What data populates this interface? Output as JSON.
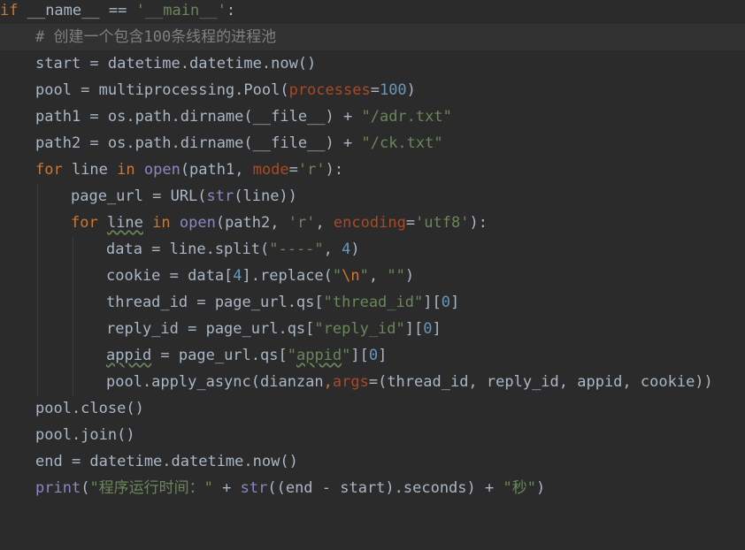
{
  "lines": [
    {
      "indent": 0,
      "current": false,
      "tokens": [
        {
          "t": "if ",
          "c": "kw"
        },
        {
          "t": "__name__",
          "c": "plain"
        },
        {
          "t": " == ",
          "c": "plain"
        },
        {
          "t": "'__main__'",
          "c": "str"
        },
        {
          "t": ":",
          "c": "plain"
        }
      ]
    },
    {
      "indent": 1,
      "current": true,
      "tokens": [
        {
          "t": "# 创建一个包含100条线程的进程池",
          "c": "cmt"
        }
      ]
    },
    {
      "indent": 1,
      "current": false,
      "tokens": [
        {
          "t": "start = datetime.datetime.now()",
          "c": "plain"
        }
      ]
    },
    {
      "indent": 1,
      "current": false,
      "tokens": [
        {
          "t": "pool = multiprocessing.Pool(",
          "c": "plain"
        },
        {
          "t": "processes",
          "c": "param"
        },
        {
          "t": "=",
          "c": "plain"
        },
        {
          "t": "100",
          "c": "num"
        },
        {
          "t": ")",
          "c": "plain"
        }
      ]
    },
    {
      "indent": 1,
      "current": false,
      "tokens": [
        {
          "t": "path1 = os.path.dirname(",
          "c": "plain"
        },
        {
          "t": "__file__",
          "c": "plain"
        },
        {
          "t": ") + ",
          "c": "plain"
        },
        {
          "t": "\"/adr.txt\"",
          "c": "str"
        }
      ]
    },
    {
      "indent": 1,
      "current": false,
      "tokens": [
        {
          "t": "path2 = os.path.dirname(",
          "c": "plain"
        },
        {
          "t": "__file__",
          "c": "plain"
        },
        {
          "t": ") + ",
          "c": "plain"
        },
        {
          "t": "\"/ck.txt\"",
          "c": "str"
        }
      ]
    },
    {
      "indent": 1,
      "current": false,
      "tokens": [
        {
          "t": "for ",
          "c": "kw"
        },
        {
          "t": "line ",
          "c": "plain"
        },
        {
          "t": "in ",
          "c": "kw"
        },
        {
          "t": "open",
          "c": "builtin"
        },
        {
          "t": "(path1, ",
          "c": "plain"
        },
        {
          "t": "mode",
          "c": "param"
        },
        {
          "t": "=",
          "c": "plain"
        },
        {
          "t": "'r'",
          "c": "str"
        },
        {
          "t": "):",
          "c": "plain"
        }
      ]
    },
    {
      "indent": 2,
      "current": false,
      "tokens": [
        {
          "t": "page_url = URL(",
          "c": "plain"
        },
        {
          "t": "str",
          "c": "builtin"
        },
        {
          "t": "(line))",
          "c": "plain"
        }
      ]
    },
    {
      "indent": 2,
      "current": false,
      "tokens": [
        {
          "t": "for ",
          "c": "kw"
        },
        {
          "t": "line",
          "c": "typo"
        },
        {
          "t": " ",
          "c": "plain"
        },
        {
          "t": "in ",
          "c": "kw"
        },
        {
          "t": "open",
          "c": "builtin"
        },
        {
          "t": "(path2, ",
          "c": "plain"
        },
        {
          "t": "'r'",
          "c": "str"
        },
        {
          "t": ", ",
          "c": "plain"
        },
        {
          "t": "encoding",
          "c": "param"
        },
        {
          "t": "=",
          "c": "plain"
        },
        {
          "t": "'utf8'",
          "c": "str"
        },
        {
          "t": "):",
          "c": "plain"
        }
      ]
    },
    {
      "indent": 3,
      "current": false,
      "tokens": [
        {
          "t": "data = line.split(",
          "c": "plain"
        },
        {
          "t": "\"----\"",
          "c": "str"
        },
        {
          "t": ", ",
          "c": "plain"
        },
        {
          "t": "4",
          "c": "num"
        },
        {
          "t": ")",
          "c": "plain"
        }
      ]
    },
    {
      "indent": 3,
      "current": false,
      "tokens": [
        {
          "t": "cookie = data[",
          "c": "plain"
        },
        {
          "t": "4",
          "c": "num"
        },
        {
          "t": "].replace(",
          "c": "plain"
        },
        {
          "t": "\"",
          "c": "str"
        },
        {
          "t": "\\n",
          "c": "esc"
        },
        {
          "t": "\"",
          "c": "str"
        },
        {
          "t": ", ",
          "c": "plain"
        },
        {
          "t": "\"\"",
          "c": "str"
        },
        {
          "t": ")",
          "c": "plain"
        }
      ]
    },
    {
      "indent": 3,
      "current": false,
      "tokens": [
        {
          "t": "thread_id = page_url.qs[",
          "c": "plain"
        },
        {
          "t": "\"thread_id\"",
          "c": "str"
        },
        {
          "t": "][",
          "c": "plain"
        },
        {
          "t": "0",
          "c": "num"
        },
        {
          "t": "]",
          "c": "plain"
        }
      ]
    },
    {
      "indent": 3,
      "current": false,
      "tokens": [
        {
          "t": "reply_id = page_url.qs[",
          "c": "plain"
        },
        {
          "t": "\"reply_id\"",
          "c": "str"
        },
        {
          "t": "][",
          "c": "plain"
        },
        {
          "t": "0",
          "c": "num"
        },
        {
          "t": "]",
          "c": "plain"
        }
      ]
    },
    {
      "indent": 3,
      "current": false,
      "tokens": [
        {
          "t": "appid",
          "c": "typo"
        },
        {
          "t": " = page_url.qs[",
          "c": "plain"
        },
        {
          "t": "\"",
          "c": "str"
        },
        {
          "t": "appid",
          "c": "str typo"
        },
        {
          "t": "\"",
          "c": "str"
        },
        {
          "t": "][",
          "c": "plain"
        },
        {
          "t": "0",
          "c": "num"
        },
        {
          "t": "]",
          "c": "plain"
        }
      ]
    },
    {
      "indent": 3,
      "current": false,
      "tokens": [
        {
          "t": "pool.apply_async(dianzan",
          "c": "plain"
        },
        {
          "t": ",",
          "c": "kw"
        },
        {
          "t": "args",
          "c": "param"
        },
        {
          "t": "=(thread_id, reply_id, appid, cookie))",
          "c": "plain"
        }
      ]
    },
    {
      "indent": 1,
      "current": false,
      "tokens": [
        {
          "t": "pool.close()",
          "c": "plain"
        }
      ]
    },
    {
      "indent": 1,
      "current": false,
      "tokens": [
        {
          "t": "pool.join()",
          "c": "plain"
        }
      ]
    },
    {
      "indent": 1,
      "current": false,
      "tokens": [
        {
          "t": "end = datetime.datetime.now()",
          "c": "plain"
        }
      ]
    },
    {
      "indent": 1,
      "current": false,
      "tokens": [
        {
          "t": "print",
          "c": "builtin"
        },
        {
          "t": "(",
          "c": "plain"
        },
        {
          "t": "\"程序运行时间：\"",
          "c": "str"
        },
        {
          "t": " + ",
          "c": "plain"
        },
        {
          "t": "str",
          "c": "builtin"
        },
        {
          "t": "((end - start).seconds) + ",
          "c": "plain"
        },
        {
          "t": "\"秒\"",
          "c": "str"
        },
        {
          "t": ")",
          "c": "plain"
        }
      ]
    }
  ]
}
